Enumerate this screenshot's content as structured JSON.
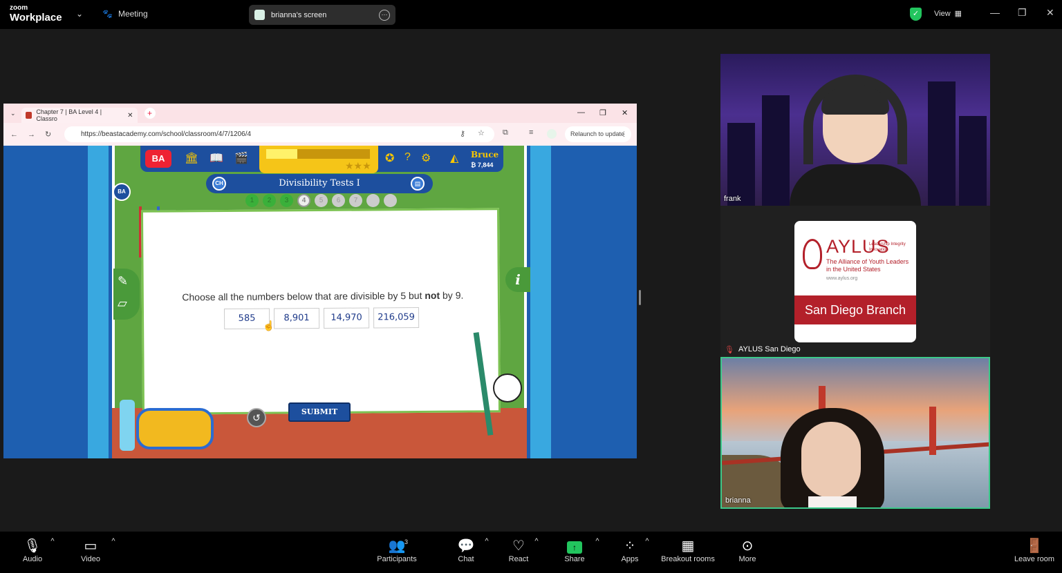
{
  "topbar": {
    "logo_small": "zoom",
    "logo_main": "Workplace",
    "meeting_label": "Meeting",
    "screen_label": "brianna's screen",
    "view_label": "View"
  },
  "browser": {
    "tab_title": "Chapter 7 | BA Level 4 | Classro",
    "url": "https://beastacademy.com/school/classroom/4/7/1206/4",
    "relaunch_label": "Relaunch to update"
  },
  "game": {
    "logo": "BA",
    "user_name": "Bruce",
    "coins": "₿ 7,844",
    "chapter_badge": "CH",
    "lesson_title": "Divisibility Tests I",
    "side_badge": "BA",
    "steps": [
      "1",
      "2",
      "3",
      "4",
      "5",
      "6",
      "7",
      "",
      ""
    ],
    "current_step": 4,
    "progress_fraction": 0.3,
    "question_pre": "Choose all the numbers below that are divisible by 5 but ",
    "question_bold": "not",
    "question_post": " by 9.",
    "answers": [
      "585",
      "8,901",
      "14,970",
      "216,059"
    ],
    "submit_label": "SUBMIT",
    "info_label": "i"
  },
  "participants": {
    "frank": "frank",
    "aylus": "AYLUS San Diego",
    "brianna": "brianna"
  },
  "aylus_card": {
    "word": "AYLUS",
    "tag": "Leadership Integrity Innovation",
    "sub": "The Alliance of Youth Leaders in the United States",
    "url": "www.aylus.org",
    "branch": "San Diego Branch"
  },
  "toolbar": {
    "audio": "Audio",
    "video": "Video",
    "participants": "Participants",
    "participants_count": "3",
    "chat": "Chat",
    "react": "React",
    "share": "Share",
    "apps": "Apps",
    "breakout": "Breakout rooms",
    "more": "More",
    "leave": "Leave room"
  },
  "icons": [
    "mic-off-icon",
    "video-off-icon",
    "participants-icon",
    "chat-icon",
    "react-icon",
    "share-icon",
    "apps-icon",
    "breakout-icon",
    "more-icon",
    "leave-icon",
    "shield-icon"
  ],
  "colors": {
    "accent_green": "#22c55e",
    "mute_red": "#e04444",
    "aylus_red": "#b3202a",
    "active_border": "#3cc98a"
  }
}
